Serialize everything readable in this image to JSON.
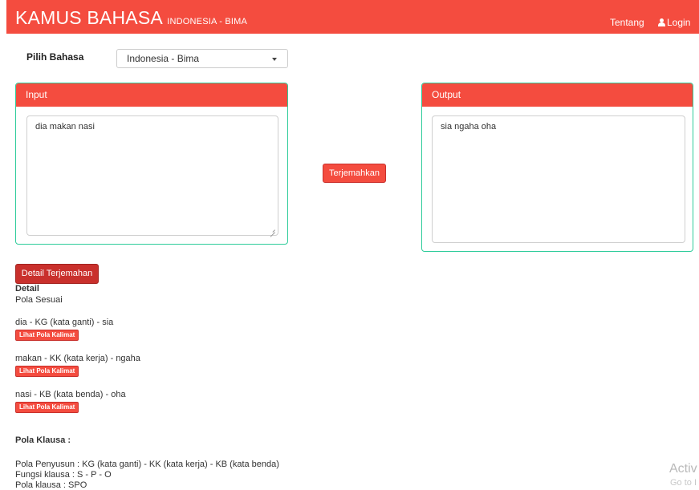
{
  "header": {
    "brand_title": "KAMUS BAHASA",
    "brand_subtitle": "INDONESIA - BIMA",
    "nav_about": "Tentang",
    "nav_login": "Login",
    "color": "#f44c3f"
  },
  "language": {
    "label": "Pilih Bahasa",
    "selected": "Indonesia - Bima"
  },
  "input_panel": {
    "title": "Input",
    "value": "dia makan nasi"
  },
  "output_panel": {
    "title": "Output",
    "value": "sia ngaha oha"
  },
  "translate_button": "Terjemahkan",
  "detail": {
    "button": "Detail Terjemahan",
    "heading": "Detail",
    "status": "Pola Sesuai",
    "pattern_button": "Lihat Pola Kalimat",
    "words": [
      "dia - KG (kata ganti) - sia",
      "makan - KK (kata kerja) - ngaha",
      "nasi - KB (kata benda) - oha"
    ],
    "clause_heading": "Pola Klausa :",
    "clause_lines": [
      "Pola Penyusun : KG (kata ganti) - KK (kata kerja) - KB (kata benda)",
      "Fungsi klausa : S - P - O",
      "Pola klausa : SPO"
    ]
  },
  "watermark": {
    "line1": "Activ",
    "line2": "Go to I"
  }
}
